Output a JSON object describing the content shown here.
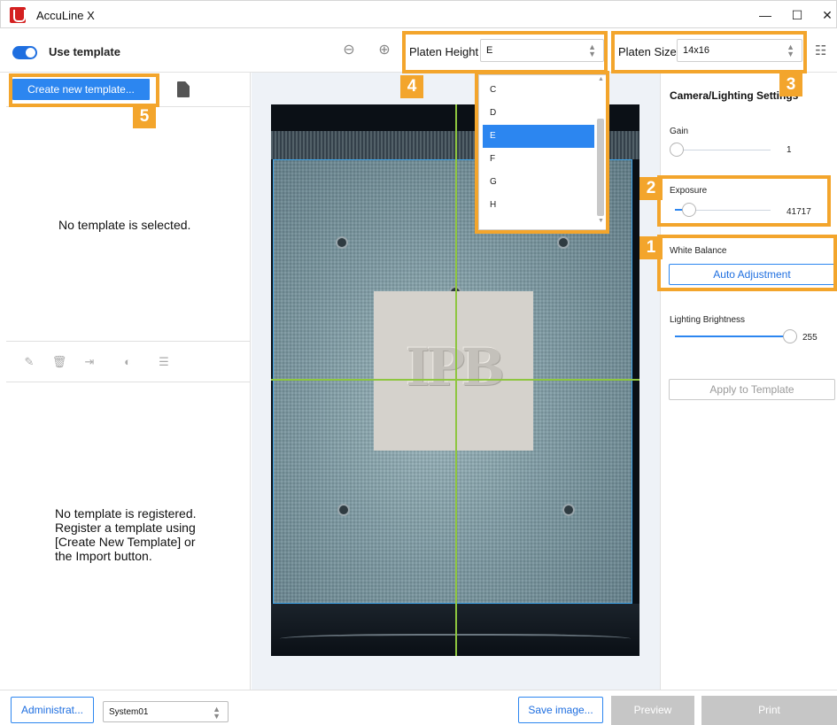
{
  "window": {
    "title": "AccuLine X",
    "minimize": "—",
    "maximize": "☐",
    "close": "✕"
  },
  "toolbar": {
    "use_template_label": "Use template",
    "use_template_on": true,
    "platen_height_label": "Platen Height",
    "platen_height_value": "E",
    "platen_size_label": "Platen Size",
    "platen_size_value": "14x16"
  },
  "platen_height_options": [
    "C",
    "D",
    "E",
    "F",
    "G",
    "H"
  ],
  "platen_height_selected": "E",
  "left_panel": {
    "create_button": "Create new template...",
    "no_template_selected": "No template is selected.",
    "no_template_registered": "No template is registered.\nRegister a template using\n[Create New Template] or\nthe Import button."
  },
  "preview": {
    "logo_text": "IPB"
  },
  "right_panel": {
    "title": "Camera/Lighting Settings",
    "gain_label": "Gain",
    "gain_value": "1",
    "exposure_label": "Exposure",
    "exposure_value": "41717",
    "white_balance_label": "White Balance",
    "auto_adjust_button": "Auto Adjustment",
    "lighting_label": "Lighting Brightness",
    "lighting_value": "255",
    "apply_button": "Apply to Template"
  },
  "bottom": {
    "admin_button": "Administrat...",
    "system_value": "System01",
    "save_button": "Save image...",
    "preview_button": "Preview",
    "print_button": "Print"
  },
  "callouts": {
    "one": "1",
    "two": "2",
    "three": "3",
    "four": "4",
    "five": "5"
  },
  "colors": {
    "accent": "#2c86f0",
    "callout": "#f3a52c",
    "crosshair": "#8ec63f",
    "disabled_button": "#c6c6c6"
  }
}
